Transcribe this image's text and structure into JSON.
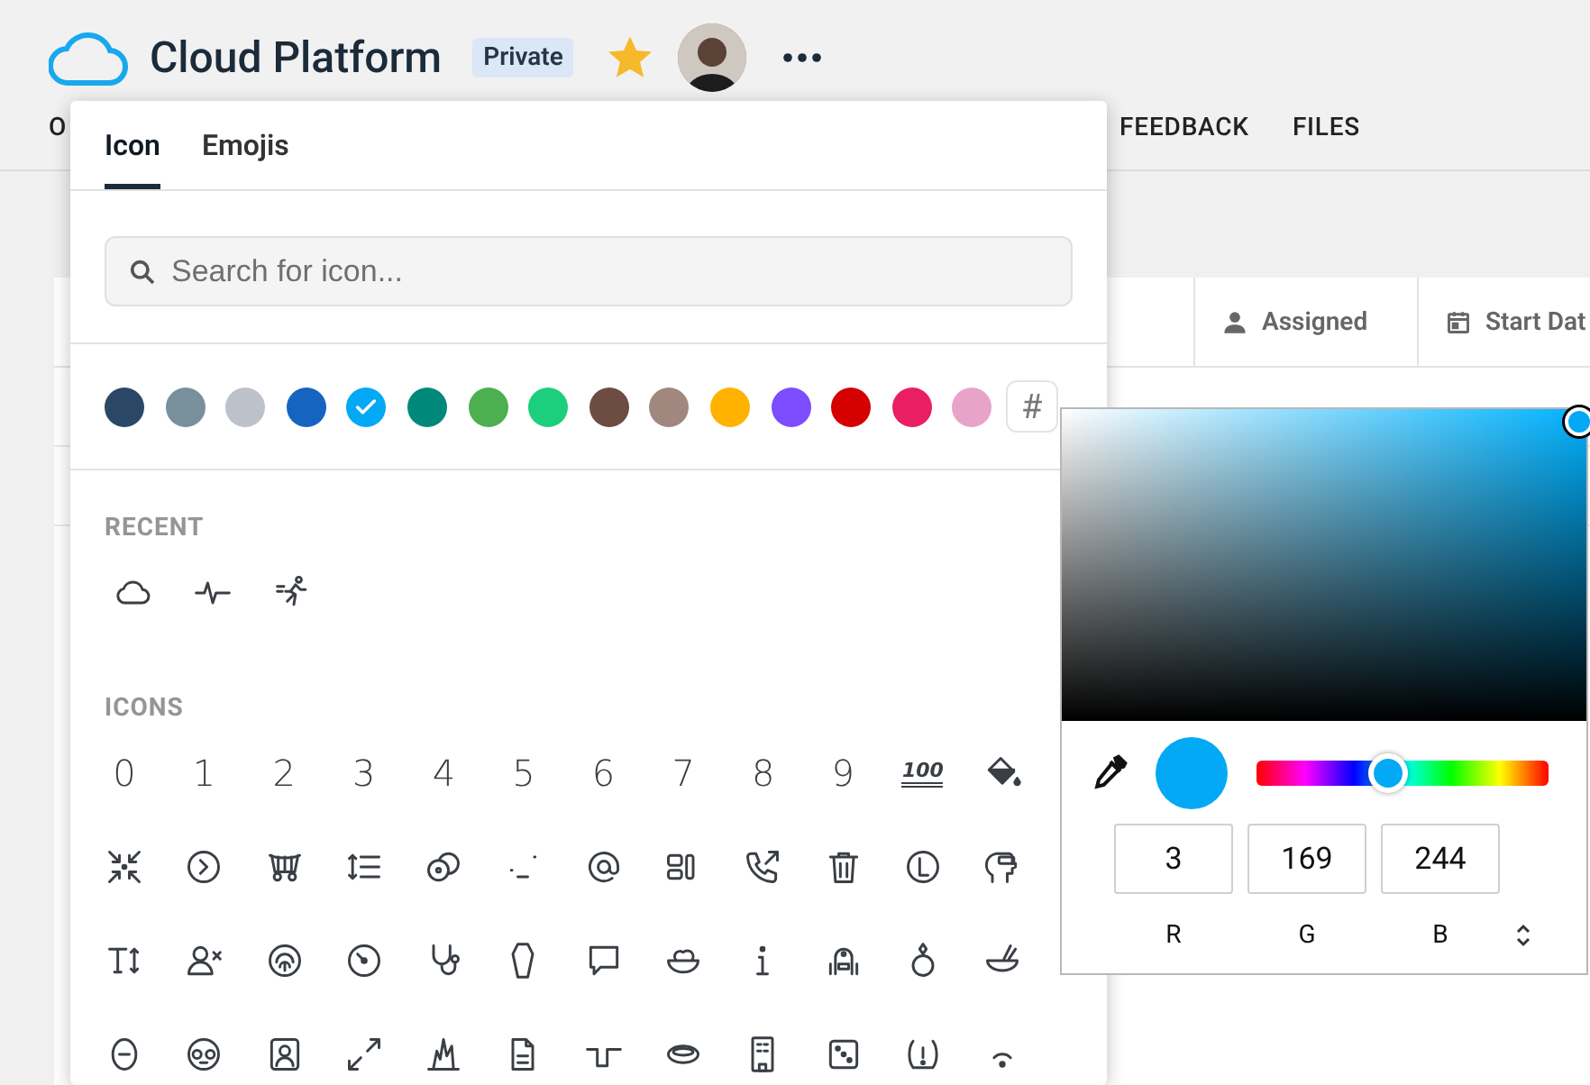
{
  "header": {
    "title": "Cloud Platform",
    "badge": "Private",
    "starred": true
  },
  "nav": [
    {
      "label": "O"
    },
    {
      "label": "FEEDBACK"
    },
    {
      "label": "FILES"
    }
  ],
  "table": {
    "columns": [
      {
        "label": "Assigned",
        "kind": "person"
      },
      {
        "label": "Start Dat",
        "kind": "calendar"
      }
    ]
  },
  "icon_picker": {
    "tabs": [
      {
        "label": "Icon",
        "selected": true
      },
      {
        "label": "Emojis",
        "selected": false
      }
    ],
    "search": {
      "placeholder": "Search for icon..."
    },
    "colors": [
      {
        "color": "#2a4866",
        "selected": false
      },
      {
        "color": "#78909c",
        "selected": false
      },
      {
        "color": "#bdc1c9",
        "selected": false
      },
      {
        "color": "#1565c0",
        "selected": false
      },
      {
        "color": "#03a9f4",
        "selected": true
      },
      {
        "color": "#00897b",
        "selected": false
      },
      {
        "color": "#4caf50",
        "selected": false
      },
      {
        "color": "#1ccf7c",
        "selected": false
      },
      {
        "color": "#6d4c41",
        "selected": false
      },
      {
        "color": "#a1887f",
        "selected": false
      },
      {
        "color": "#ffb300",
        "selected": false
      },
      {
        "color": "#7c4dff",
        "selected": false
      },
      {
        "color": "#d50000",
        "selected": false
      },
      {
        "color": "#e91e63",
        "selected": false
      },
      {
        "color": "#e8a4c8",
        "selected": false
      }
    ],
    "custom_color": "#",
    "sections": [
      {
        "title": "RECENT",
        "icons": [
          {
            "kind": "icon"
          },
          {
            "kind": "icon"
          },
          {
            "kind": "icon"
          }
        ]
      },
      {
        "title": "ICONS",
        "icons": [
          {
            "kind": "glyph",
            "text": "0"
          },
          {
            "kind": "glyph",
            "text": "1"
          },
          {
            "kind": "glyph",
            "text": "2"
          },
          {
            "kind": "glyph",
            "text": "3"
          },
          {
            "kind": "glyph",
            "text": "4"
          },
          {
            "kind": "glyph",
            "text": "5"
          },
          {
            "kind": "glyph",
            "text": "6"
          },
          {
            "kind": "glyph",
            "text": "7"
          },
          {
            "kind": "glyph",
            "text": "8"
          },
          {
            "kind": "glyph",
            "text": "9"
          },
          {
            "kind": "badge",
            "text": "100"
          },
          {
            "kind": "icon"
          },
          {
            "kind": "icon"
          },
          {
            "kind": "icon"
          },
          {
            "kind": "icon"
          },
          {
            "kind": "icon"
          },
          {
            "kind": "icon"
          },
          {
            "kind": "icon"
          },
          {
            "kind": "icon"
          },
          {
            "kind": "icon"
          },
          {
            "kind": "icon"
          },
          {
            "kind": "icon"
          },
          {
            "kind": "icon"
          },
          {
            "kind": "icon"
          },
          {
            "kind": "icon"
          },
          {
            "kind": "icon"
          },
          {
            "kind": "icon"
          },
          {
            "kind": "icon"
          },
          {
            "kind": "icon"
          },
          {
            "kind": "icon"
          },
          {
            "kind": "icon"
          },
          {
            "kind": "icon"
          },
          {
            "kind": "icon"
          },
          {
            "kind": "icon"
          },
          {
            "kind": "icon"
          },
          {
            "kind": "icon"
          },
          {
            "kind": "icon"
          },
          {
            "kind": "icon"
          },
          {
            "kind": "icon"
          },
          {
            "kind": "icon"
          },
          {
            "kind": "icon"
          },
          {
            "kind": "icon"
          },
          {
            "kind": "icon"
          },
          {
            "kind": "icon"
          },
          {
            "kind": "icon"
          },
          {
            "kind": "icon"
          },
          {
            "kind": "icon"
          },
          {
            "kind": "icon"
          }
        ]
      }
    ]
  },
  "color_picker": {
    "hue": {
      "level": 0.45
    },
    "channels": [
      {
        "value": "3",
        "label": "R"
      },
      {
        "value": "169",
        "label": "G"
      },
      {
        "value": "244",
        "label": "B"
      }
    ]
  }
}
